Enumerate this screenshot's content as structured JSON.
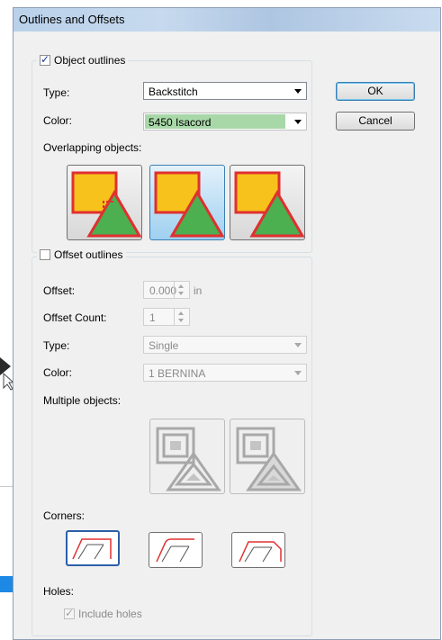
{
  "dialog": {
    "title": "Outlines and Offsets",
    "ok_label": "OK",
    "cancel_label": "Cancel"
  },
  "object_outlines": {
    "label": "Object outlines",
    "checked": true,
    "type_label": "Type:",
    "type_value": "Backstitch",
    "color_label": "Color:",
    "color_value": "5450 Isacord",
    "color_swatch": "#a8d8a8",
    "overlap_label": "Overlapping objects:"
  },
  "offset_outlines": {
    "label": "Offset outlines",
    "checked": false,
    "offset_label": "Offset:",
    "offset_value": "0.000",
    "offset_unit": "in",
    "count_label": "Offset Count:",
    "count_value": "1",
    "type_label": "Type:",
    "type_value": "Single",
    "color_label": "Color:",
    "color_value": "1 BERNINA",
    "multiple_label": "Multiple objects:",
    "corners_label": "Corners:",
    "holes_label": "Holes:",
    "include_holes_label": "Include holes",
    "include_holes_checked": true
  },
  "colors": {
    "accent": "#3c7fb1",
    "outline_red": "#e03030",
    "square_yellow": "#f7c21b",
    "triangle_green": "#4caf50"
  }
}
